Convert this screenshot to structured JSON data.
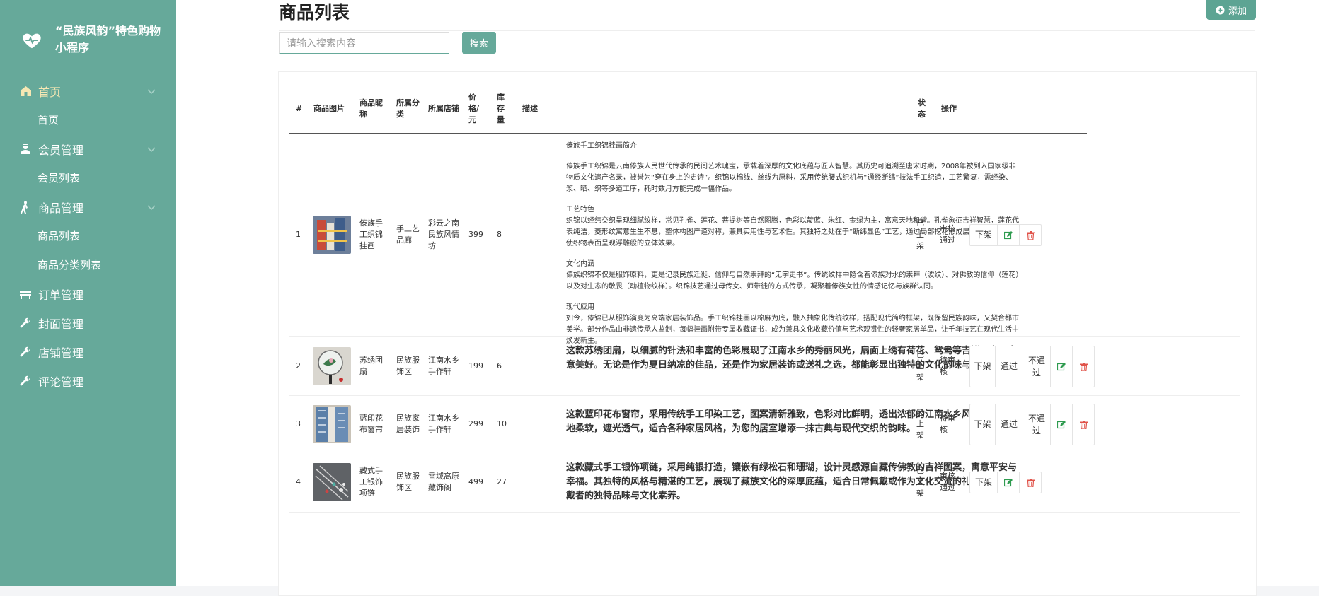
{
  "app": {
    "title": "“民族风韵”特色购物小程序"
  },
  "sidebar": {
    "groups": [
      {
        "label": "首页",
        "active": true,
        "sub": [
          "首页"
        ]
      },
      {
        "label": "会员管理",
        "sub": [
          "会员列表"
        ]
      },
      {
        "label": "商品管理",
        "sub": [
          "商品列表",
          "商品分类列表"
        ]
      },
      {
        "label": "订单管理",
        "sub": []
      },
      {
        "label": "封面管理",
        "sub": []
      },
      {
        "label": "店铺管理",
        "sub": []
      },
      {
        "label": "评论管理",
        "sub": []
      }
    ]
  },
  "page": {
    "title": "商品列表",
    "add_label": "添加",
    "search_placeholder": "请输入搜索内容",
    "search_label": "搜索"
  },
  "table": {
    "headers": [
      "#",
      "商品图片",
      "商品昵称",
      "所属分类",
      "所属店铺",
      "价格/元",
      "库存量",
      "描述",
      "状态",
      "操作"
    ],
    "rows": [
      {
        "index": "1",
        "name": "傣族手工织锦挂画",
        "category": "手工艺品廊",
        "shop": "彩云之南民族风情坊",
        "price": "399",
        "stock": "8",
        "desc_title": "傣族手工织锦挂画简介",
        "desc_p1": "傣族手工织锦是云南傣族人民世代传承的民间艺术瑰宝，承载着深厚的文化底蕴与匠人智慧。其历史可追溯至唐宋时期，2008年被列入国家级非物质文化遗产名录，被誉为“穿在身上的史诗”。织锦以棉线、丝线为原料，采用传统腰式织机与“通经断纬”技法手工织造，工艺繁复，需经染、浆、晒、织等多道工序，耗时数月方能完成一幅作品。",
        "desc_h2": "工艺特色",
        "desc_p2": "织锦以经纬交织呈现细腻纹样，常见孔雀、莲花、菩提树等自然图腾，色彩以靛蓝、朱红、金绿为主，寓意天地和谐。孔雀象征吉祥智慧，莲花代表纯洁，菱形纹寓意生生不息，整体构图严谨对称，兼具实用性与艺术性。其独特之处在于“断纬显色”工艺，通过局部挖花形成层次丰富的图案，使织物表面呈现浮雕般的立体效果。",
        "desc_h3": "文化内涵",
        "desc_p3": "傣族织锦不仅是服饰原料，更是记录民族迁徙、信仰与自然崇拜的“无字史书”。传统纹样中隐含着傣族对水的崇拜（波纹）、对佛教的信仰（莲花）以及对生态的敬畏（动植物纹样）。织锦技艺通过母传女、师带徒的方式传承，凝聚着傣族女性的情感记忆与族群认同。",
        "desc_h4": "现代应用",
        "desc_p4": "如今，傣锦已从服饰演变为高端家居装饰品。手工织锦挂画以棉麻为底，融入抽象化传统纹样，搭配现代简约框架，既保留民族韵味，又契合都市美学。部分作品由非遗传承人监制，每幅挂画附带专属收藏证书，成为兼具文化收藏价值与艺术观赏性的轻奢家居单品，让千年技艺在现代生活中焕发新生。",
        "status": "已上架",
        "review": "审核通过",
        "actions": [
          "下架"
        ]
      },
      {
        "index": "2",
        "name": "苏绣团扇",
        "category": "民族服饰区",
        "shop": "江南水乡手作轩",
        "price": "199",
        "stock": "6",
        "desc": "这款苏绣团扇，以细腻的针法和丰富的色彩展现了江南水乡的秀丽风光，扇面上绣有荷花、鸳鸯等吉祥图案，寓意美好。无论是作为夏日纳凉的佳品，还是作为家居装饰或送礼之选，都能彰显出独特的文化韵味与艺术价值。",
        "status": "已上架",
        "review": "待审核",
        "actions": [
          "下架",
          "通过",
          "不通过"
        ]
      },
      {
        "index": "3",
        "name": "蓝印花布窗帘",
        "category": "民族家居装饰",
        "shop": "江南水乡手作轩",
        "price": "299",
        "stock": "10",
        "desc": "这款蓝印花布窗帘，采用传统手工印染工艺，图案清新雅致，色彩对比鲜明，透出浓郁的江南水乡风情。布料质地柔软，遮光透气，适合各种家居风格，为您的居室增添一抹古典与现代交织的韵味。",
        "status": "已上架",
        "review": "待审核",
        "actions": [
          "下架",
          "通过",
          "不通过"
        ]
      },
      {
        "index": "4",
        "name": "藏式手工银饰项链",
        "category": "民族服饰区",
        "shop": "雪域高原藏饰阁",
        "price": "499",
        "stock": "27",
        "desc": "这款藏式手工银饰项链，采用纯银打造，镶嵌有绿松石和珊瑚，设计灵感源自藏传佛教的吉祥图案，寓意平安与幸福。其独特的风格与精湛的工艺，展现了藏族文化的深厚底蕴，适合日常佩戴或作为文化交流的礼物，彰显佩戴者的独特品味与文化素养。",
        "status": "已上架",
        "review": "审核通过",
        "actions": [
          "下架"
        ]
      }
    ]
  },
  "colors": {
    "sidebar": "#66a99a",
    "accent": "#5da493",
    "active_menu": "#f6e7b3",
    "edit": "#2e9b4f",
    "delete": "#e0534a"
  }
}
